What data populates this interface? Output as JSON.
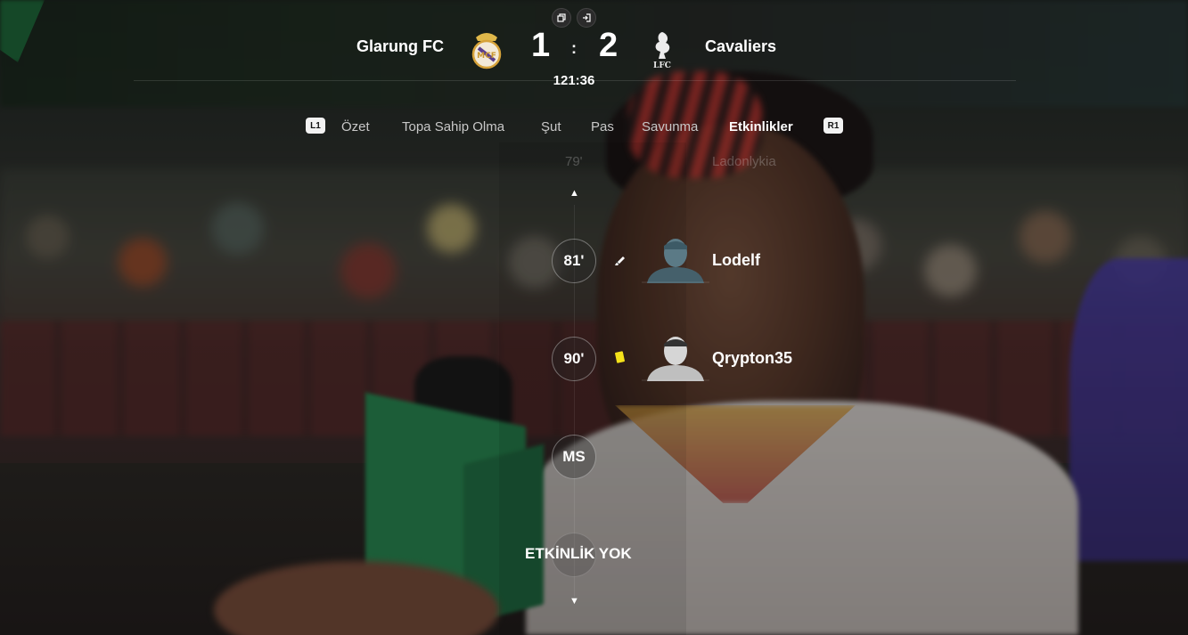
{
  "header": {
    "top_icons": [
      "copy-icon",
      "exit-icon"
    ],
    "home_team": "Glarung FC",
    "away_team": "Cavaliers",
    "home_score": "1",
    "away_score": "2",
    "separator": ":",
    "clock": "121:36",
    "away_crest_text": "LFC"
  },
  "tabs": {
    "left_shoulder": "L1",
    "right_shoulder": "R1",
    "items": [
      "Özet",
      "Topa Sahip Olma",
      "Şut",
      "Pas",
      "Savunma",
      "Etkinlikler"
    ],
    "active": "Etkinlikler"
  },
  "timeline": {
    "previous_row": {
      "minute": "79'",
      "player": "Ladonlykia"
    },
    "events": [
      {
        "minute": "81'",
        "icon": "substitution-icon",
        "player": "Lodelf"
      },
      {
        "minute": "90'",
        "icon": "yellow-card-icon",
        "player": "Qrypton35"
      }
    ],
    "full_time_label": "MS",
    "no_events_label": "ETKİNLİK YOK"
  },
  "colors": {
    "yellow_card": "#f5e21a",
    "active_tab": "#ffffff",
    "inactive_tab": "#c8c8c8"
  }
}
